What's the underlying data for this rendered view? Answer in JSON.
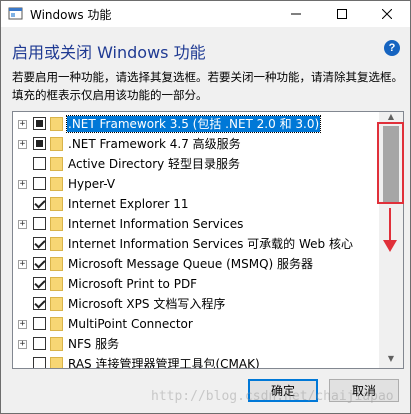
{
  "window": {
    "title": "Windows 功能",
    "heading": "启用或关闭 Windows 功能",
    "description": "若要启用一种功能，请选择其复选框。若要关闭一种功能，请清除其复选框。填充的框表示仅启用该功能的一部分。",
    "help_glyph": "?",
    "min_glyph": "—",
    "max_glyph": "☐",
    "close_glyph": "✕"
  },
  "features": [
    {
      "label": ".NET Framework 3.5 (包括 .NET 2.0 和 3.0)",
      "expander": "+",
      "state": "partial",
      "selected": true
    },
    {
      "label": ".NET Framework 4.7 高级服务",
      "expander": "+",
      "state": "partial",
      "selected": false
    },
    {
      "label": "Active Directory 轻型目录服务",
      "expander": "",
      "state": "unchecked",
      "selected": false
    },
    {
      "label": "Hyper-V",
      "expander": "+",
      "state": "unchecked",
      "selected": false
    },
    {
      "label": "Internet Explorer 11",
      "expander": "",
      "state": "checked",
      "selected": false
    },
    {
      "label": "Internet Information Services",
      "expander": "+",
      "state": "unchecked",
      "selected": false
    },
    {
      "label": "Internet Information Services 可承载的 Web 核心",
      "expander": "",
      "state": "checked",
      "selected": false
    },
    {
      "label": "Microsoft Message Queue (MSMQ) 服务器",
      "expander": "+",
      "state": "checked",
      "selected": false
    },
    {
      "label": "Microsoft Print to PDF",
      "expander": "",
      "state": "checked",
      "selected": false
    },
    {
      "label": "Microsoft XPS 文档写入程序",
      "expander": "",
      "state": "checked",
      "selected": false
    },
    {
      "label": "MultiPoint Connector",
      "expander": "+",
      "state": "unchecked",
      "selected": false
    },
    {
      "label": "NFS 服务",
      "expander": "+",
      "state": "unchecked",
      "selected": false
    },
    {
      "label": "RAS 连接管理器管理工具包(CMAK)",
      "expander": "",
      "state": "unchecked",
      "selected": false
    }
  ],
  "scrollbar": {
    "up_glyph": "▲",
    "down_glyph": "▼",
    "thumb_position": 0.0
  },
  "buttons": {
    "ok": "确定",
    "cancel": "取消"
  },
  "watermark": "http://blog.csdn.net/chaijiapao",
  "colors": {
    "accent": "#0078d7",
    "highlight_red": "#e0303a"
  }
}
